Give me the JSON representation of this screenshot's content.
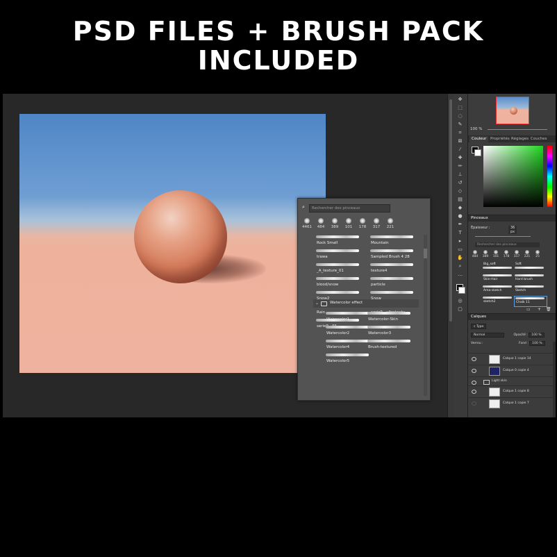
{
  "banner": {
    "line1": "PSD FILES + BRUSH PACK",
    "line2": "INCLUDED"
  },
  "brush_popup": {
    "search_placeholder": "Rechercher des pinceaux",
    "presets": [
      "4461",
      "484",
      "389",
      "101",
      "178",
      "317",
      "221"
    ],
    "brushes": [
      [
        "Rock Small",
        "Mountain"
      ],
      [
        "trawa",
        "Sampled Brush 4 28"
      ],
      [
        "_A_texture_01",
        "texture4"
      ],
      [
        "blood/snow",
        "particle"
      ],
      [
        "Snow2",
        "Snow"
      ],
      [
        "Rain",
        "serieP - ultratextu..."
      ],
      [
        "serieP - 01",
        ""
      ]
    ],
    "group_label": "Watercolor effect",
    "group_brushes": [
      [
        "Watercolor1",
        "Watercolor-Skin"
      ],
      [
        "Watercolor2",
        "Watercolor3"
      ],
      [
        "Watercolor4",
        "Brush-textured"
      ],
      [
        "Watercolor5",
        ""
      ]
    ]
  },
  "navigator": {
    "zoom": "100 %"
  },
  "color_tabs": [
    "Couleur",
    "Propriétés",
    "Réglages",
    "Couches"
  ],
  "brushes_panel": {
    "title": "Pinceaux",
    "size_label": "Épaisseur :",
    "size_value": "36 px",
    "search_placeholder": "Rechercher des pinceaux",
    "presets": [
      "484",
      "389",
      "101",
      "178",
      "317",
      "221",
      "25"
    ],
    "items": [
      [
        "Big_soft",
        "Soft"
      ],
      [
        "Skin-Hair",
        "Hard brush"
      ],
      [
        "Ama-sketch",
        "Sketch"
      ],
      [
        "sketch2",
        "Chalk 11"
      ]
    ],
    "selected": "Chalk 11"
  },
  "layers_panel": {
    "title": "Calques",
    "filter": "Type",
    "blend": "Normal",
    "opacity_label": "Opacité :",
    "opacity": "100 %",
    "lock_label": "Verrou :",
    "fill_label": "Fond :",
    "fill": "100 %",
    "layers": [
      {
        "name": "Calque 1 copie 14",
        "group": false
      },
      {
        "name": "Calque 0 copie 4",
        "group": false
      },
      {
        "name": "Light skin",
        "group": true
      },
      {
        "name": "Calque 1 copie 8",
        "group": false
      },
      {
        "name": "Calque 1 copie 7",
        "group": false
      }
    ]
  },
  "colors": {
    "sky": "#4f86c6",
    "ground": "#efb29e",
    "panel": "#3c3c3c",
    "workspace": "#282828"
  }
}
